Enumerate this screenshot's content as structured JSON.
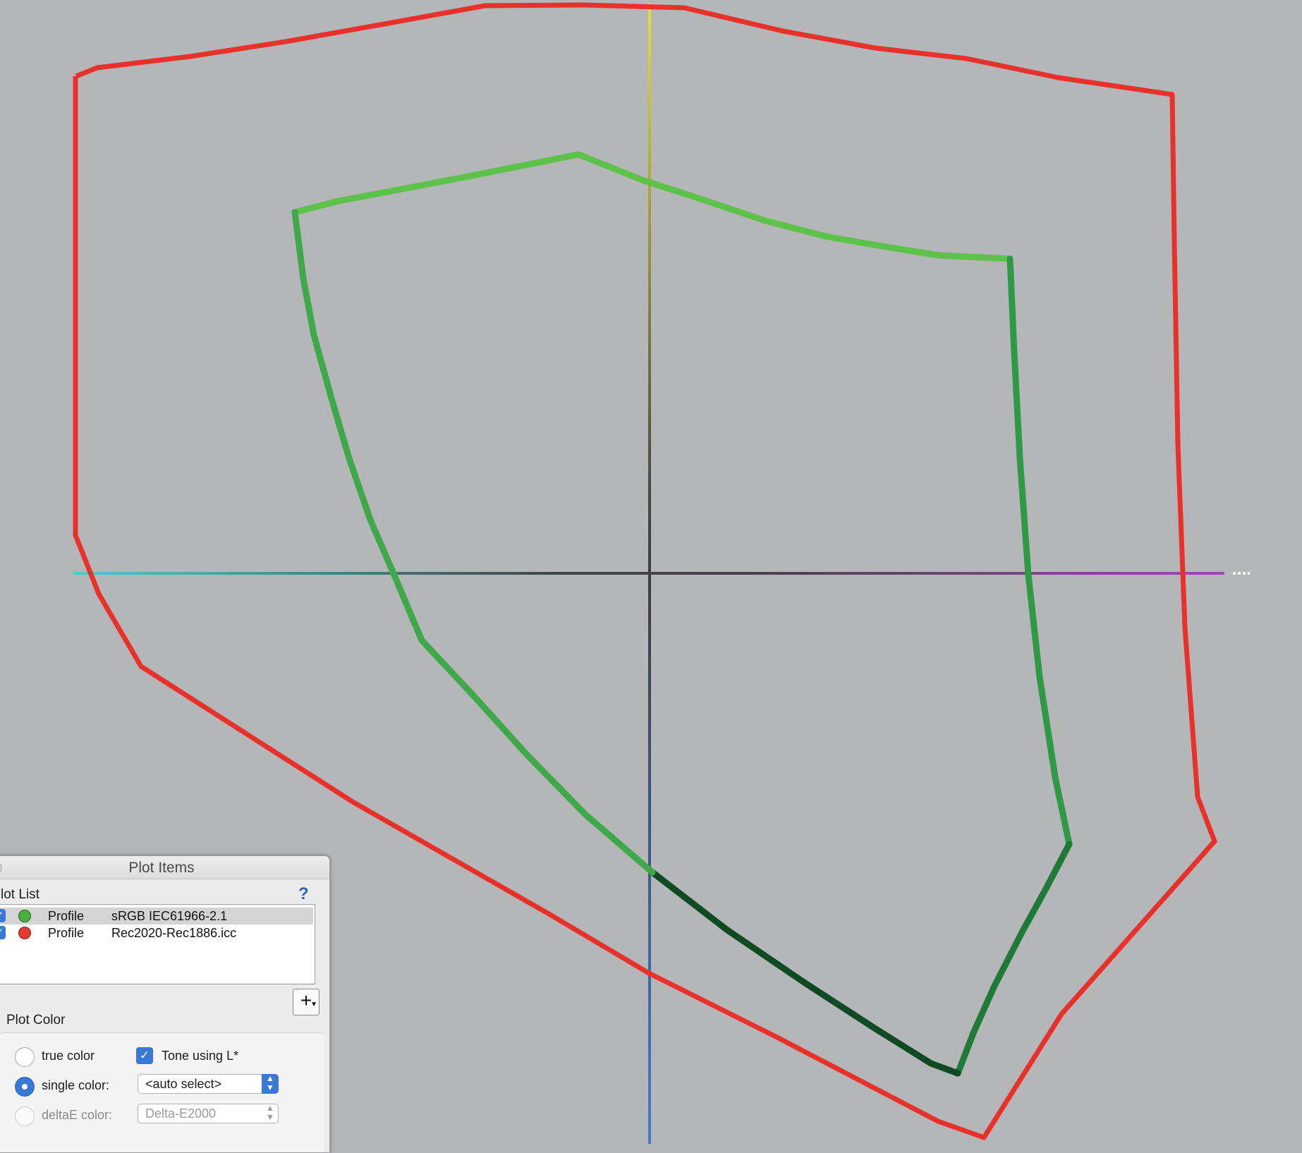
{
  "plot_items_panel": {
    "title": "Plot Items",
    "plot_list_label": "lot List",
    "help_label": "?",
    "rows": [
      {
        "checked": true,
        "dot_color": "#4caf3f",
        "kind": "Profile",
        "name": "sRGB IEC61966-2.1",
        "selected": true
      },
      {
        "checked": true,
        "dot_color": "#e53a2e",
        "kind": "Profile",
        "name": "Rec2020-Rec1886.icc",
        "selected": false
      }
    ],
    "add_button_label": "+",
    "plot_color_label": "Plot Color",
    "options": {
      "true_color": {
        "label": "true color",
        "selected": false
      },
      "single_color": {
        "label": "single color:",
        "selected": true
      },
      "deltae_color": {
        "label": "deltaE color:",
        "selected": false,
        "disabled": true
      }
    },
    "tone_checkbox": {
      "label": "Tone using L*",
      "checked": true
    },
    "single_color_select": {
      "value": "<auto select>"
    },
    "deltae_select": {
      "value": "Delta-E2000"
    }
  },
  "colors": {
    "background": "#b4b6b7",
    "rec2020_outline": "#e8312a",
    "srgb_outline_light": "#5cc24a",
    "srgb_outline_dark": "#0f4a24",
    "axis_yellow": "#e6e236",
    "axis_blue": "#3f7bd0",
    "axis_cyan": "#4ec9d2",
    "axis_magenta": "#9b49b0"
  }
}
